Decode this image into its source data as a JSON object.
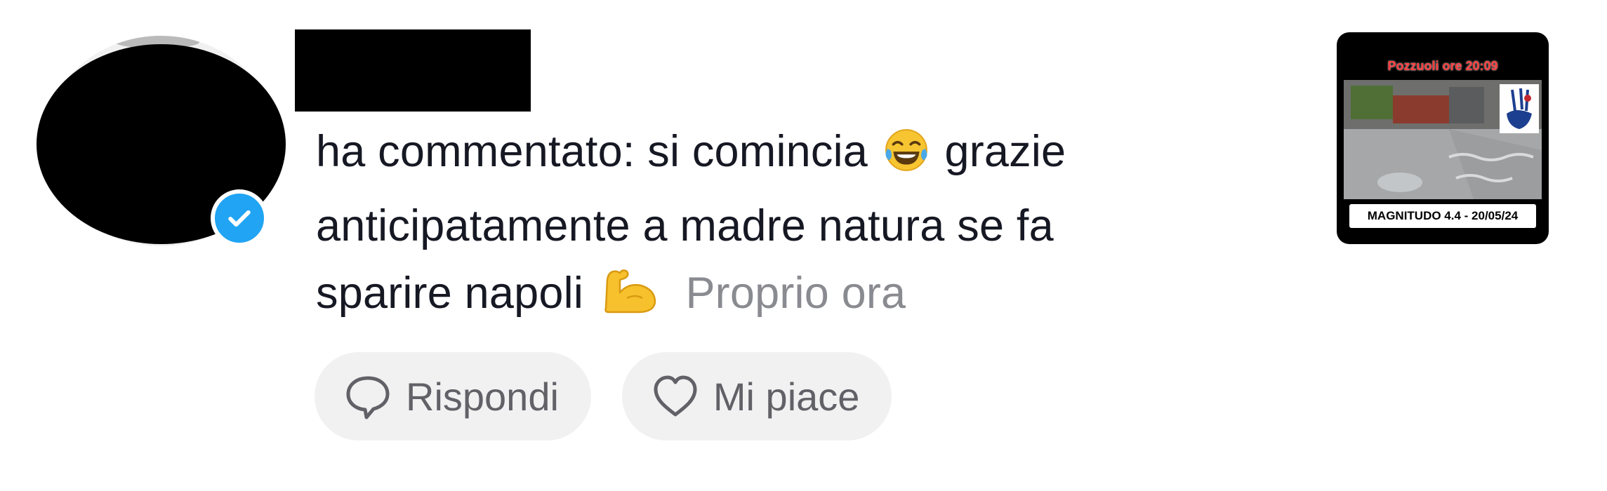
{
  "comment": {
    "line1_text": "ha commentato: si comincia",
    "line1_emoji": "face-with-tears-of-joy",
    "line1_tail": "grazie",
    "line2_text": "anticipatamente a madre natura se fa",
    "line3_text": "sparire napoli",
    "line3_emoji": "flexed-biceps",
    "timestamp": "Proprio ora"
  },
  "actions": {
    "reply_label": "Rispondi",
    "like_label": "Mi piace"
  },
  "thumbnail": {
    "title": "Pozzuoli ore 20:09",
    "caption": "MAGNITUDO 4.4 - 20/05/24"
  },
  "colors": {
    "text": "#161823",
    "muted": "#8a8b91",
    "pill_bg": "#f1f1f2",
    "verified": "#20a4f3"
  }
}
